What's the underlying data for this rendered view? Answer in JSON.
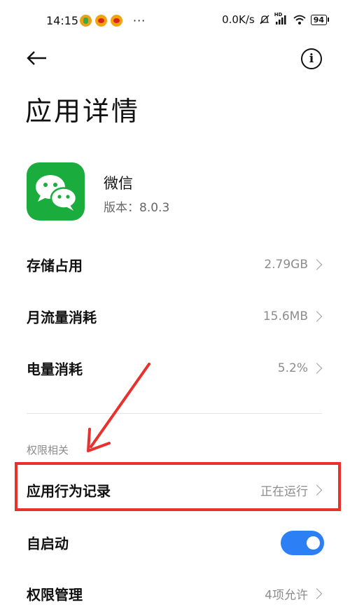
{
  "status_bar": {
    "time": "14:15",
    "more": "···",
    "net_speed": "0.0K/s",
    "hd_label": "HD",
    "battery": "94"
  },
  "toolbar": {
    "back_icon": "arrow-left-icon",
    "info_icon": "info-circle-icon",
    "info_glyph": "i"
  },
  "page": {
    "title": "应用详情"
  },
  "app": {
    "name": "微信",
    "version": "版本：8.0.3",
    "icon": "wechat-logo-icon",
    "icon_color": "#1aad3d"
  },
  "rows": [
    {
      "label": "存储占用",
      "value": "2.79GB"
    },
    {
      "label": "月流量消耗",
      "value": "15.6MB"
    },
    {
      "label": "电量消耗",
      "value": "5.2%"
    }
  ],
  "permissions": {
    "section_label": "权限相关",
    "behavior_record": {
      "label": "应用行为记录",
      "value": "正在运行"
    },
    "autostart": {
      "label": "自启动",
      "enabled": true
    },
    "permission_manage": {
      "label": "权限管理",
      "value": "4项允许"
    }
  },
  "annotation": {
    "highlight_color": "#e8302c",
    "arrow_color": "#e8302c"
  },
  "colors": {
    "toggle_on": "#2d7ff5",
    "secondary_text": "#8c8c8c"
  }
}
